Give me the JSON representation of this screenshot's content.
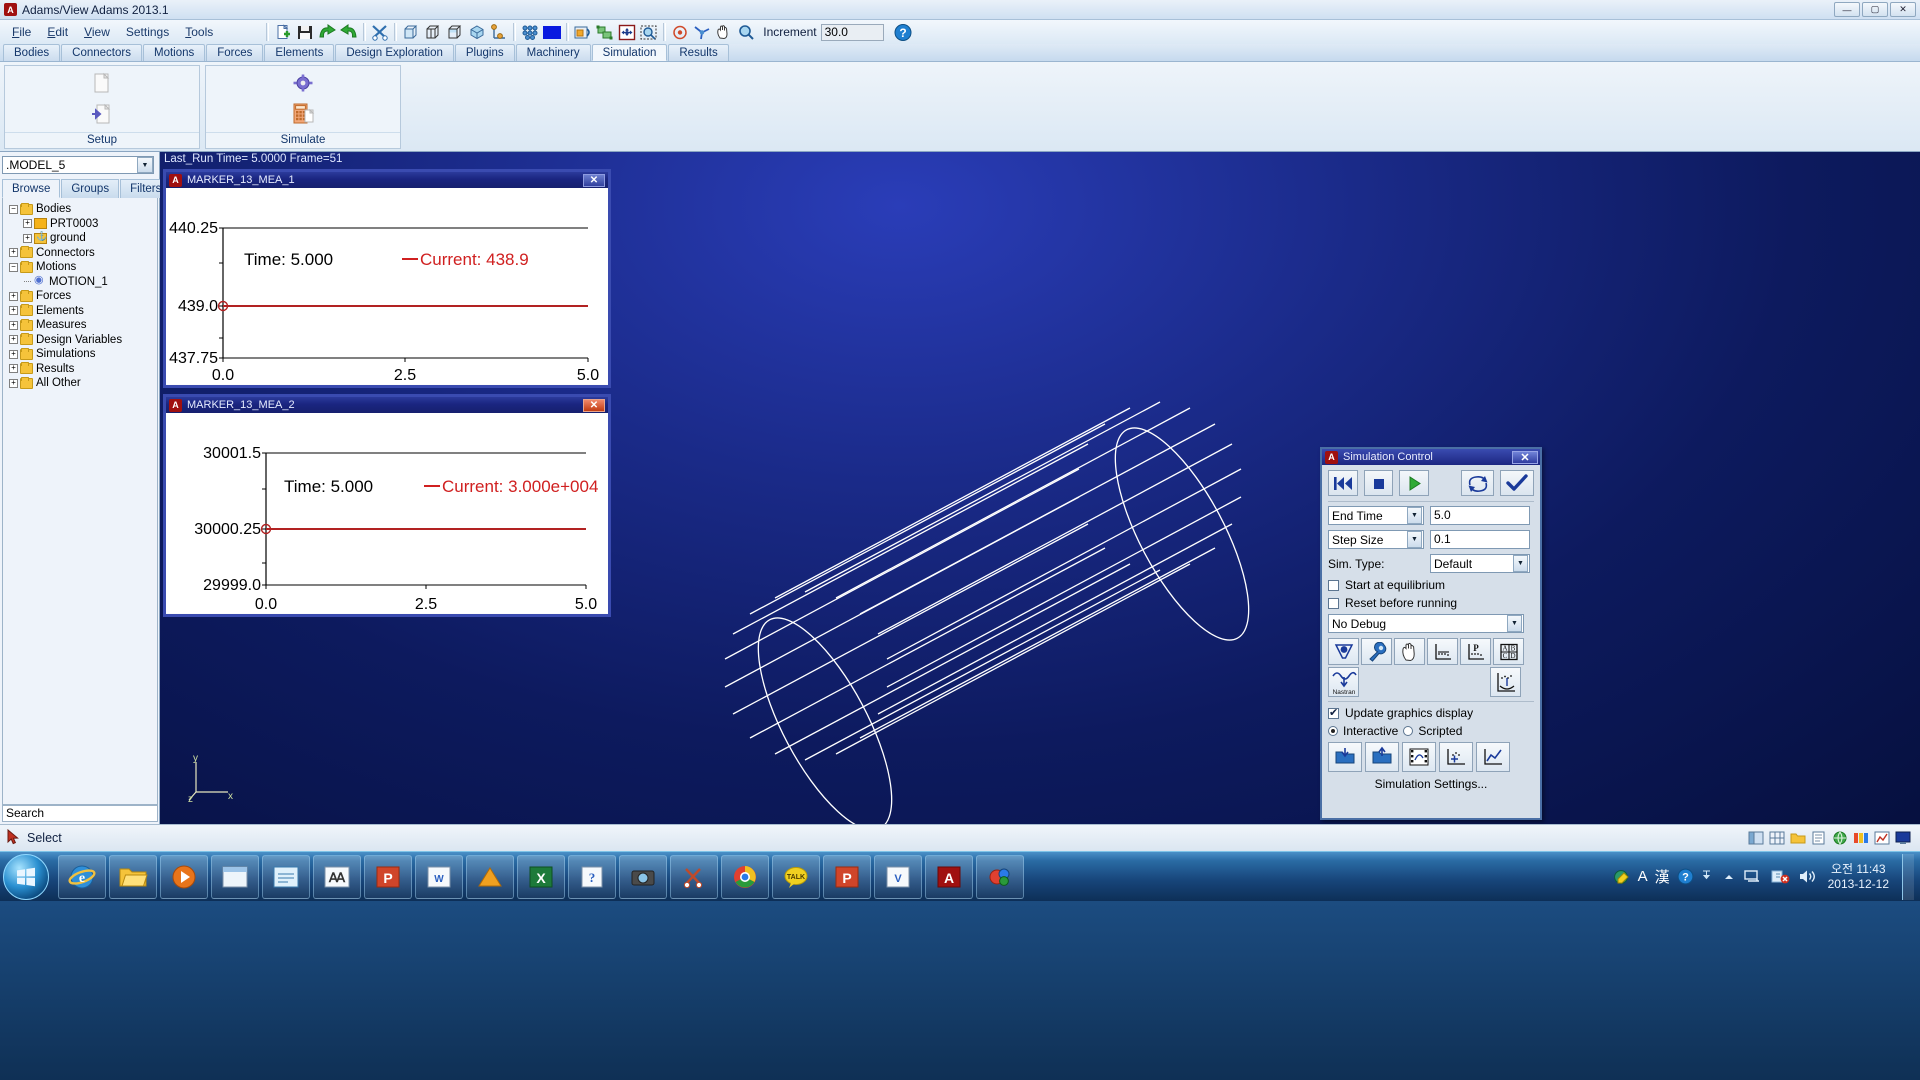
{
  "window": {
    "title": "Adams/View Adams 2013.1",
    "app_badge": "A",
    "buttons": {
      "minimize": "—",
      "maximize": "▢",
      "close": "✕"
    }
  },
  "menu": {
    "items": [
      "File",
      "Edit",
      "View",
      "Settings",
      "Tools"
    ]
  },
  "toolbar": {
    "increment_label": "Increment",
    "increment_value": "30.0",
    "icons": [
      "new-file-icon",
      "save-icon",
      "redo-icon",
      "undo-icon",
      "scissors-icon",
      "box-view-icon",
      "wireframe-view-icon",
      "shaded-box-icon",
      "cube-icon",
      "axis-icon",
      "molecule-icon",
      "color-swatch-icon",
      "render-icon",
      "group-select-icon",
      "move-icon",
      "zoom-select-icon",
      "target-icon",
      "rotate-icon",
      "pan-hand-icon",
      "zoom-icon",
      "help-icon"
    ]
  },
  "ribbon": {
    "tabs": [
      {
        "label": "Bodies",
        "active": false
      },
      {
        "label": "Connectors",
        "active": false
      },
      {
        "label": "Motions",
        "active": false
      },
      {
        "label": "Forces",
        "active": false
      },
      {
        "label": "Elements",
        "active": false
      },
      {
        "label": "Design Exploration",
        "active": false
      },
      {
        "label": "Plugins",
        "active": false
      },
      {
        "label": "Machinery",
        "active": false
      },
      {
        "label": "Simulation",
        "active": true
      },
      {
        "label": "Results",
        "active": false
      }
    ],
    "groups": [
      {
        "label": "Setup",
        "icons": [
          "document-icon",
          "document-import-icon"
        ]
      },
      {
        "label": "Simulate",
        "icons": [
          "gear-icon",
          "calculator-icon"
        ]
      }
    ]
  },
  "sidebar": {
    "model_name": ".MODEL_5",
    "tabs": [
      {
        "label": "Browse",
        "active": true
      },
      {
        "label": "Groups",
        "active": false
      },
      {
        "label": "Filters",
        "active": false
      }
    ],
    "tree": [
      {
        "label": "Bodies",
        "expander": "minus",
        "icon": "folder-icon",
        "indent": 1
      },
      {
        "label": "PRT0003",
        "expander": "plus",
        "icon": "part-icon",
        "indent": 2
      },
      {
        "label": "ground",
        "expander": "plus",
        "icon": "ground-icon",
        "indent": 2
      },
      {
        "label": "Connectors",
        "expander": "plus",
        "icon": "folder-icon",
        "indent": 1
      },
      {
        "label": "Motions",
        "expander": "minus",
        "icon": "folder-icon",
        "indent": 1
      },
      {
        "label": "MOTION_1",
        "expander": "dash",
        "icon": "motion-icon",
        "indent": 2
      },
      {
        "label": "Forces",
        "expander": "plus",
        "icon": "folder-icon",
        "indent": 1
      },
      {
        "label": "Elements",
        "expander": "plus",
        "icon": "folder-icon",
        "indent": 1
      },
      {
        "label": "Measures",
        "expander": "plus",
        "icon": "folder-icon",
        "indent": 1
      },
      {
        "label": "Design Variables",
        "expander": "plus",
        "icon": "folder-icon",
        "indent": 1
      },
      {
        "label": "Simulations",
        "expander": "plus",
        "icon": "folder-icon",
        "indent": 1
      },
      {
        "label": "Results",
        "expander": "plus",
        "icon": "folder-icon",
        "indent": 1
      },
      {
        "label": "All Other",
        "expander": "plus",
        "icon": "folder-icon",
        "indent": 1
      }
    ],
    "search_placeholder": "Search"
  },
  "viewport": {
    "status": "Last_Run   Time= 5.0000  Frame=51",
    "axis_labels": {
      "x": "x",
      "y": "y",
      "z": "z"
    },
    "model_shape": "cylinder-wireframe"
  },
  "plots": [
    {
      "title": "MARKER_13_MEA_1",
      "badge": "A",
      "close_label": "✕",
      "close_style": "blue",
      "chart_data": {
        "type": "line",
        "title": "MARKER_13_MEA_1",
        "annotation_time_label": "Time:",
        "annotation_time_value": "5.000",
        "annotation_series_label": "Current:",
        "annotation_series_value": "438.9",
        "series_color": "#b22222",
        "xlabel": "",
        "ylabel": "",
        "x": [
          0.0,
          2.5,
          5.0
        ],
        "y": [
          439.0,
          439.0,
          439.0
        ],
        "xticks": [
          "0.0",
          "2.5",
          "5.0"
        ],
        "yticks": [
          "440.25",
          "439.0",
          "437.75"
        ],
        "xlim": [
          0.0,
          5.0
        ],
        "ylim": [
          437.75,
          440.25
        ],
        "grid": false
      }
    },
    {
      "title": "MARKER_13_MEA_2",
      "badge": "A",
      "close_label": "✕",
      "close_style": "red",
      "chart_data": {
        "type": "line",
        "title": "MARKER_13_MEA_2",
        "annotation_time_label": "Time:",
        "annotation_time_value": "5.000",
        "annotation_series_label": "Current:",
        "annotation_series_value": "3.000e+004",
        "series_color": "#b22222",
        "xlabel": "",
        "ylabel": "",
        "x": [
          0.0,
          2.5,
          5.0
        ],
        "y": [
          30000.25,
          30000.25,
          30000.25
        ],
        "xticks": [
          "0.0",
          "2.5",
          "5.0"
        ],
        "yticks": [
          "30001.5",
          "30000.25",
          "29999.0"
        ],
        "xlim": [
          0.0,
          5.0
        ],
        "ylim": [
          29999.0,
          30001.5
        ],
        "grid": false
      }
    }
  ],
  "sim_control": {
    "title": "Simulation Control",
    "badge": "A",
    "close_label": "✕",
    "transport": [
      {
        "name": "rewind-button",
        "glyph": "rewind-icon"
      },
      {
        "name": "stop-button",
        "glyph": "stop-icon"
      },
      {
        "name": "play-button",
        "glyph": "play-icon"
      }
    ],
    "right_buttons": [
      {
        "name": "reset-button",
        "glyph": "reset-icon"
      },
      {
        "name": "apply-button",
        "glyph": "check-icon"
      }
    ],
    "fields": [
      {
        "combo": "End Time",
        "value": "5.0"
      },
      {
        "combo": "Step Size",
        "value": "0.1"
      }
    ],
    "sim_type_label": "Sim. Type:",
    "sim_type_value": "Default",
    "checks": [
      {
        "label": "Start at equilibrium",
        "checked": false
      },
      {
        "label": "Reset before running",
        "checked": false
      }
    ],
    "debug_value": "No Debug",
    "tool_icons_row1": [
      "equilibrium-icon",
      "wrench-icon",
      "hand-icon",
      "plot-points-icon",
      "plot-p-icon",
      "abcd-icon"
    ],
    "tool_icons_row2": [
      "nastran-icon",
      "plot-anchor-icon"
    ],
    "nastran_label": "Nastran",
    "update_graphics": {
      "label": "Update graphics display",
      "checked": true
    },
    "mode": {
      "interactive": "Interactive",
      "scripted": "Scripted",
      "selected": "Interactive"
    },
    "bottom_icons": [
      "save-sim-icon",
      "load-sim-icon",
      "animate-icon",
      "plot-add-icon",
      "plot-view-icon"
    ],
    "settings_label": "Simulation Settings..."
  },
  "statusbar": {
    "mode_icon": "select-cursor-icon",
    "mode_text": "Select",
    "right_icons": [
      "panel-icon",
      "grid-icon",
      "folder-icon",
      "note-icon",
      "globe-icon",
      "palette-icon",
      "chart-icon",
      "monitor-icon"
    ]
  },
  "taskbar": {
    "start_label": "start-orb",
    "apps": [
      "internet-explorer-icon",
      "folder-explorer-icon",
      "media-player-icon",
      "window-icon",
      "app-window-icon",
      "acad-icon",
      "powerpoint-icon",
      "word-icon",
      "autodesk-icon",
      "excel-icon",
      "pdf-icon",
      "camera-icon",
      "scissors-icon",
      "chrome-icon",
      "kakao-talk-icon",
      "powerpoint2-icon",
      "visio-icon",
      "adams-icon",
      "solidworks-icon"
    ],
    "tray": [
      "ime-pen-icon",
      "ime-A",
      "ime-han",
      "help-circle-icon",
      "chevron-up-icon",
      "network-icon",
      "security-icon",
      "volume-icon"
    ],
    "ime_a": "A",
    "ime_han": "漢",
    "clock_time": "오전 11:43",
    "clock_date": "2013-12-12"
  }
}
